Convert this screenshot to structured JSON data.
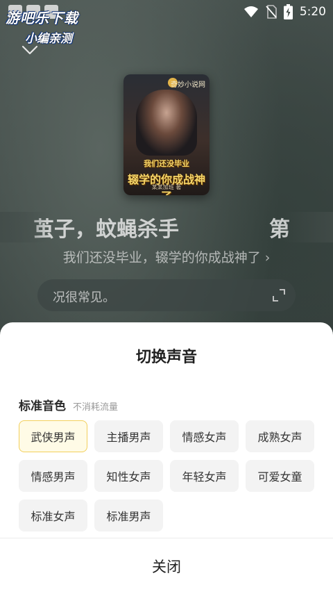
{
  "status_bar": {
    "time": "5:20",
    "icons": [
      "wifi-icon",
      "no-sim-icon",
      "battery-charging-icon"
    ]
  },
  "watermark": {
    "line1": "游吧乐下载",
    "line2": "小编亲测"
  },
  "player": {
    "cover": {
      "badge": "奇妙小说网",
      "title_line1": "我们还没毕业",
      "title_line2": "辍学的你成战神了",
      "author": "某某加班 著"
    },
    "chapter_scroll_text": "茧子，蚊蝇杀手",
    "chapter_scroll_text_2": "第",
    "book_title": "我们还没毕业，辍学的你成战神了",
    "lyric_text": "况很常见。"
  },
  "voice_sheet": {
    "title": "切换声音",
    "section_title": "标准音色",
    "section_subtitle": "不消耗流量",
    "selected_index": 0,
    "voices": [
      "武侠男声",
      "主播男声",
      "情感女声",
      "成熟女声",
      "情感男声",
      "知性女声",
      "年轻女声",
      "可爱女童",
      "标准女声",
      "标准男声"
    ],
    "close_label": "关闭"
  },
  "colors": {
    "selected_border": "#f2cf5b",
    "selected_bg": "#fffbe6",
    "chip_bg": "#f3f3f3"
  }
}
